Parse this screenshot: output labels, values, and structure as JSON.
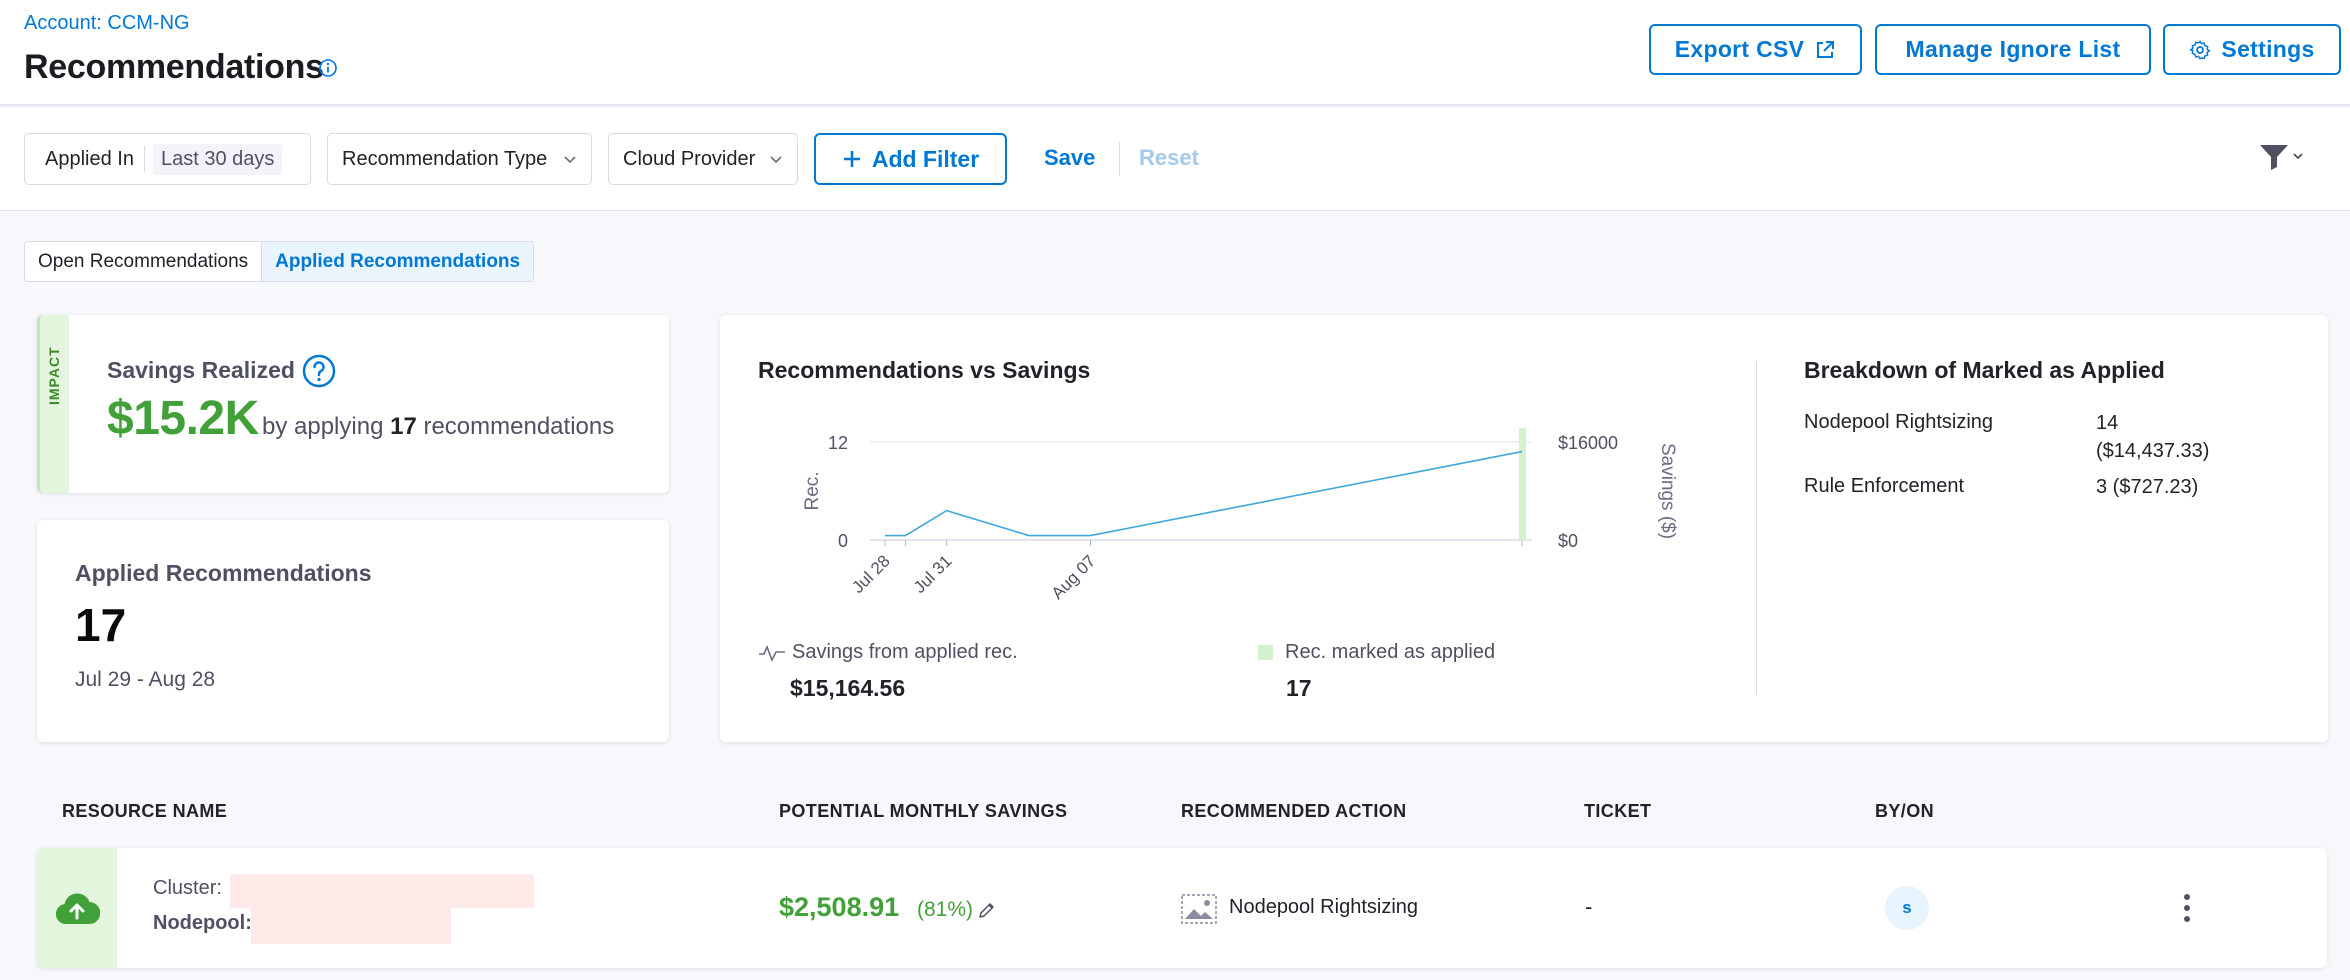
{
  "header": {
    "account_link": "Account: CCM-NG",
    "title": "Recommendations",
    "buttons": {
      "export_csv": "Export CSV",
      "manage_ignore_list": "Manage Ignore List",
      "settings": "Settings"
    }
  },
  "filter_bar": {
    "applied_in_label": "Applied In",
    "applied_in_value": "Last 30 days",
    "recommendation_type": "Recommendation Type",
    "cloud_provider": "Cloud Provider",
    "add_filter": "Add Filter",
    "save": "Save",
    "reset": "Reset"
  },
  "tabs": [
    {
      "label": "Open Recommendations",
      "active": false
    },
    {
      "label": "Applied Recommendations",
      "active": true
    }
  ],
  "impact_card": {
    "strip_label": "IMPACT",
    "title": "Savings Realized",
    "amount": "$15.2K",
    "desc_prefix": "by applying",
    "desc_count": "17",
    "desc_suffix": "recommendations"
  },
  "applied_card": {
    "title": "Applied Recommendations",
    "count": "17",
    "range": "Jul 29 - Aug 28"
  },
  "chart_card": {
    "title": "Recommendations vs Savings",
    "legend": [
      {
        "label": "Savings from applied rec.",
        "value": "$15,164.56"
      },
      {
        "label": "Rec. marked as applied",
        "value": "17"
      }
    ]
  },
  "chart_data": {
    "type": "line",
    "title": "Recommendations vs Savings",
    "xlabel": "",
    "ylabel": "Rec.",
    "y2label": "Savings ($)",
    "ylim": [
      0,
      12
    ],
    "y2lim": [
      0,
      16000
    ],
    "y_ticks": [
      "12",
      "0"
    ],
    "y2_ticks": [
      "$16000",
      "$0"
    ],
    "x_tick_labels": [
      "Jul 28",
      "Jul 31",
      "Aug 07"
    ],
    "x": [
      "Jul 28",
      "Jul 29",
      "Jul 31",
      "Aug 04",
      "Aug 07",
      "Aug 28"
    ],
    "series": [
      {
        "name": "Savings from applied rec.",
        "axis": "right",
        "color": "#3fa7db",
        "values": [
          727,
          727,
          4800,
          727,
          727,
          14437
        ]
      },
      {
        "name": "Rec. marked as applied",
        "axis": "left",
        "type": "bar",
        "color": "#d4f0cc",
        "values": [
          0,
          0,
          0,
          0,
          0,
          17
        ]
      }
    ],
    "grid": true,
    "legend": "bottom"
  },
  "breakdown": {
    "title": "Breakdown of Marked as Applied",
    "rows": [
      {
        "label": "Nodepool Rightsizing",
        "value_line1": "14",
        "value_line2": "($14,437.33)"
      },
      {
        "label": "Rule Enforcement",
        "value_line1": "3 ($727.23)",
        "value_line2": ""
      }
    ]
  },
  "table": {
    "headers": [
      "RESOURCE NAME",
      "POTENTIAL MONTHLY SAVINGS",
      "RECOMMENDED ACTION",
      "TICKET",
      "BY/ON"
    ],
    "rows": [
      {
        "cluster_label": "Cluster:",
        "nodepool_label": "Nodepool:",
        "savings": "$2,508.91",
        "percent": "(81%)",
        "action": "Nodepool Rightsizing",
        "ticket": "-",
        "by_initial": "s"
      }
    ]
  },
  "colors": {
    "accent": "#0278d5",
    "savings_green": "#42a038",
    "line": "#3fa7db",
    "bar": "#d4f0cc",
    "redaction": "#ffe9e9"
  },
  "icons": {
    "export": "external-link-icon",
    "settings": "gear-icon",
    "info": "info-icon",
    "help": "help-circle-icon",
    "filter": "funnel-icon",
    "resource": "cloud-upload-icon",
    "action": "image-placeholder-icon",
    "more": "kebab-icon"
  }
}
